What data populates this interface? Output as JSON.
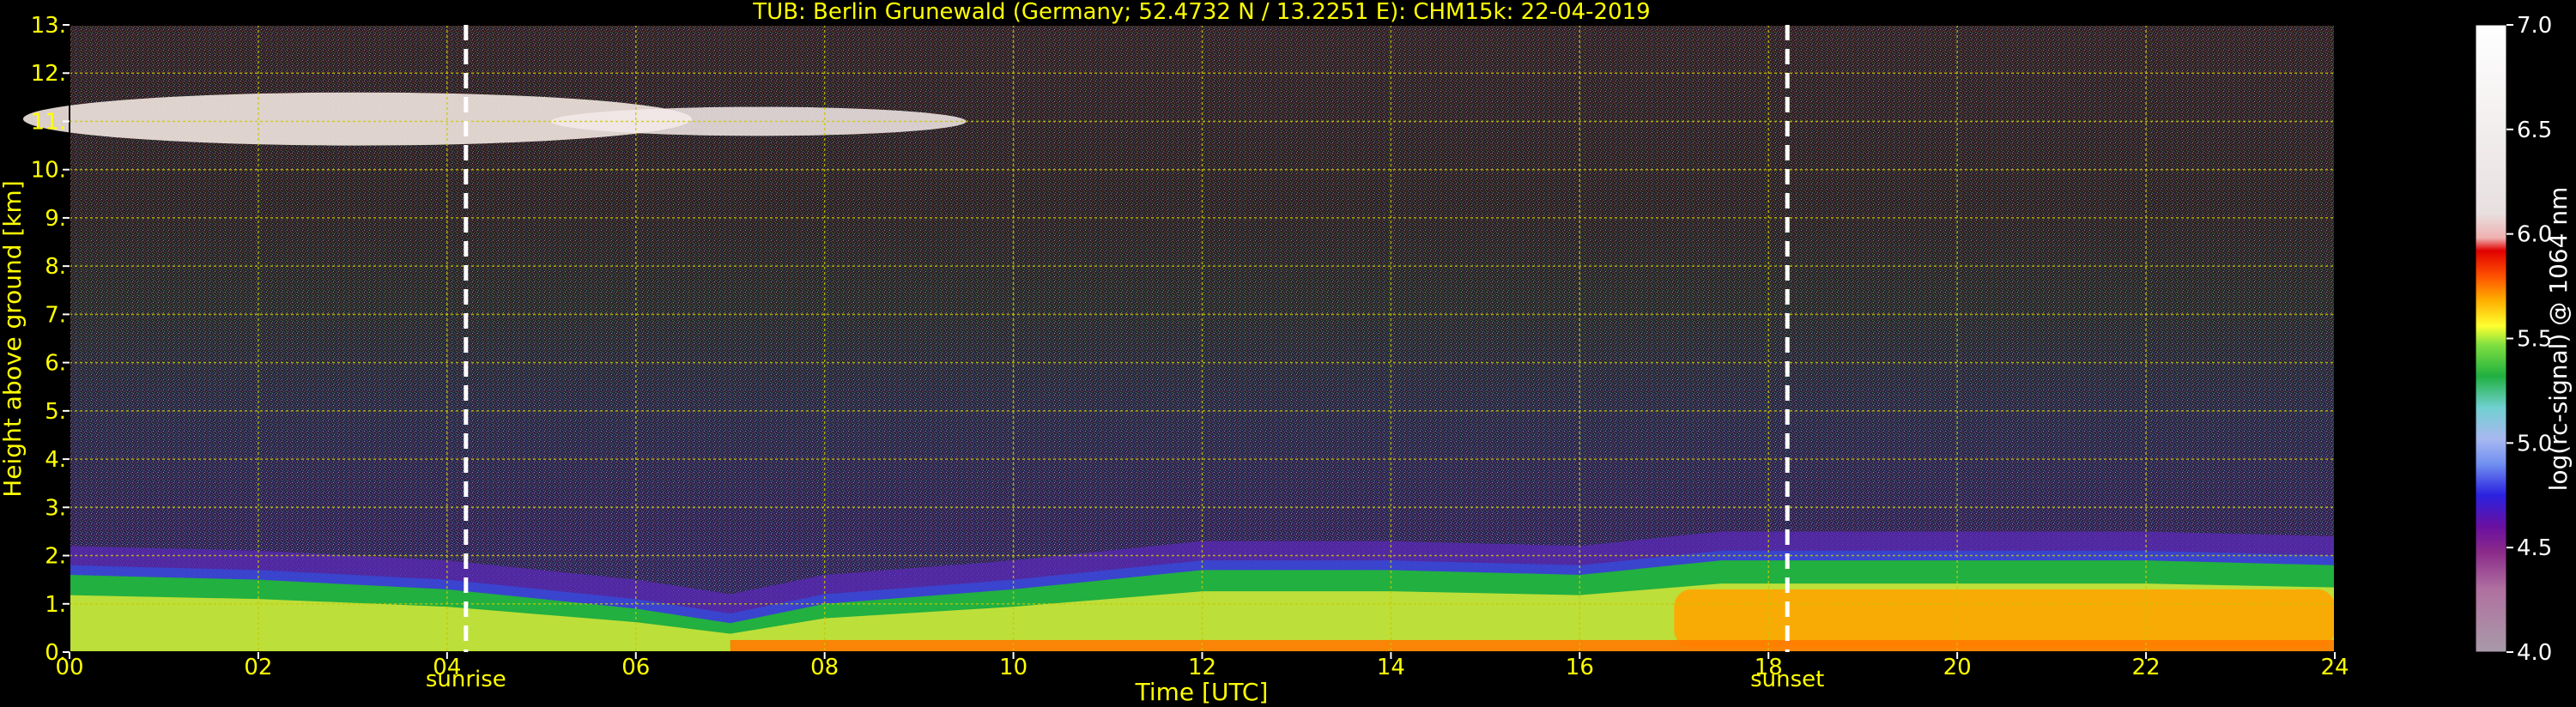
{
  "chart_data": {
    "type": "heatmap",
    "title": "TUB: Berlin Grunewald (Germany; 52.4732 N / 13.2251 E):    CHM15k: 22-04-2019",
    "xlabel": "Time [UTC]",
    "ylabel": "Height above ground [km]",
    "xlim": [
      0,
      24
    ],
    "ylim": [
      0,
      13
    ],
    "x_ticks": [
      "00",
      "02",
      "04",
      "06",
      "08",
      "10",
      "12",
      "14",
      "16",
      "18",
      "20",
      "22",
      "24"
    ],
    "y_ticks": [
      "0.",
      "1.",
      "2.",
      "3.",
      "4.",
      "5.",
      "6.",
      "7.",
      "8.",
      "9.",
      "10.",
      "11.",
      "12.",
      "13."
    ],
    "grid": true,
    "annotations": [
      {
        "label": "sunrise",
        "time": 4.2
      },
      {
        "label": "sunset",
        "time": 18.2
      }
    ],
    "colorbar": {
      "label": "log(rc-signal) @ 1064 nm",
      "range": [
        4.0,
        7.0
      ],
      "ticks": [
        "4.0",
        "4.5",
        "5.0",
        "5.5",
        "6.0",
        "6.5",
        "7.0"
      ]
    },
    "features": {
      "cirrus_cloud": {
        "start": 0,
        "end": 8.5,
        "bottom": 10.5,
        "top": 11.6
      },
      "boundary_layer_top": [
        [
          0,
          1.6
        ],
        [
          2,
          1.5
        ],
        [
          4,
          1.3
        ],
        [
          6,
          0.9
        ],
        [
          7,
          0.6
        ],
        [
          8,
          1.0
        ],
        [
          10,
          1.3
        ],
        [
          12,
          1.7
        ],
        [
          14,
          1.7
        ],
        [
          16,
          1.6
        ],
        [
          17.5,
          1.9
        ],
        [
          20,
          1.9
        ],
        [
          22,
          1.9
        ],
        [
          24,
          1.8
        ]
      ]
    }
  },
  "colors": {
    "text": "#ffff00",
    "grid": "#c8c800",
    "marker": "#ffffff",
    "background": "#000000"
  }
}
